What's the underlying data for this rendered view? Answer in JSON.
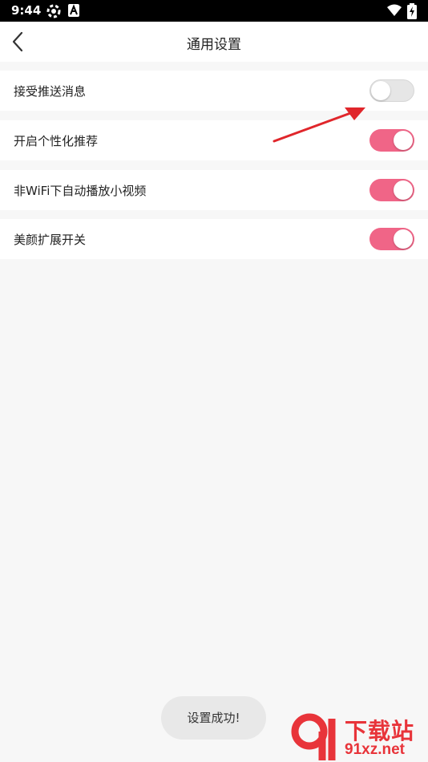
{
  "status_bar": {
    "time": "9:44",
    "icons": [
      "settings-gear-icon",
      "accessibility-a-icon",
      "wifi-icon",
      "battery-charging-icon"
    ]
  },
  "header": {
    "title": "通用设置",
    "back_icon": "chevron-left-icon"
  },
  "settings": [
    {
      "label": "接受推送消息",
      "enabled": false
    },
    {
      "label": "开启个性化推荐",
      "enabled": true
    },
    {
      "label": "非WiFi下自动播放小视频",
      "enabled": true
    },
    {
      "label": "美颜扩展开关",
      "enabled": true
    }
  ],
  "toast": {
    "text": "设置成功!"
  },
  "annotation": {
    "color": "#e0262b",
    "icon": "red-arrow"
  },
  "watermark": {
    "brand": "下载站",
    "domain": "91xz.net"
  },
  "colors": {
    "toggle_on": "#f06587",
    "toggle_off": "#e6e6e6",
    "background": "#f7f7f7",
    "watermark": "#e8343a"
  }
}
